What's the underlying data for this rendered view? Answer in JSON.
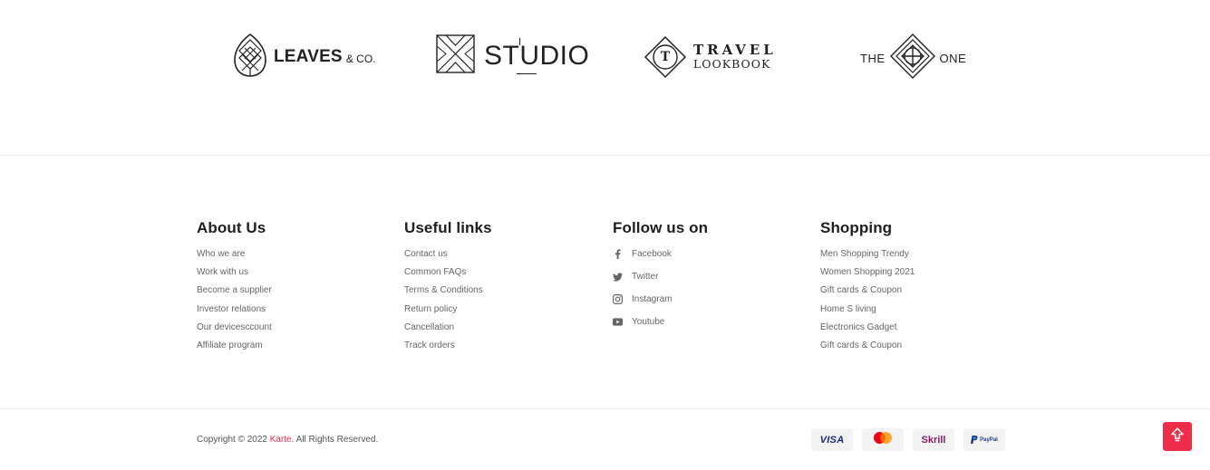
{
  "brands": {
    "leaves": {
      "name": "LEAVES",
      "suffix": "& CO."
    },
    "studio": {
      "name": "STUDIO"
    },
    "travel": {
      "emblem": "T",
      "top": "TRAVEL",
      "bottom": "LOOKBOOK"
    },
    "theone": {
      "left": "THE",
      "right": "ONE"
    }
  },
  "footer": {
    "about": {
      "title": "About Us",
      "links": [
        "Who we are",
        "Work with us",
        "Become a supplier",
        "Investor relations",
        "Our devicesccount",
        "Affiliate program"
      ]
    },
    "useful": {
      "title": "Useful links",
      "links": [
        "Contact us",
        "Common FAQs",
        "Terms & Conditions",
        "Return policy",
        "Cancellation",
        "Track orders"
      ]
    },
    "follow": {
      "title": "Follow us on",
      "links": [
        {
          "label": "Facebook",
          "icon": "facebook-icon"
        },
        {
          "label": "Twitter",
          "icon": "twitter-icon"
        },
        {
          "label": "Instagram",
          "icon": "instagram-icon"
        },
        {
          "label": "Youtube",
          "icon": "youtube-icon"
        }
      ]
    },
    "shopping": {
      "title": "Shopping",
      "links": [
        "Men Shopping Trendy",
        "Women Shopping 2021",
        "Gift cards & Coupon",
        "Home S living",
        "Electronics Gadget",
        "Gift cards & Coupon"
      ]
    }
  },
  "bottom": {
    "copyright_prefix": "Copyright © 2022 ",
    "brand": "Karte",
    "copyright_suffix": ". All Rights Reserved.",
    "payments": {
      "visa": "VISA",
      "mastercard": "mastercard",
      "skrill": "Skrill",
      "paypal": "PayPal"
    }
  },
  "colors": {
    "accent": "#ee2d4a",
    "text": "#222222",
    "muted": "#666666",
    "divider": "#ececec"
  }
}
